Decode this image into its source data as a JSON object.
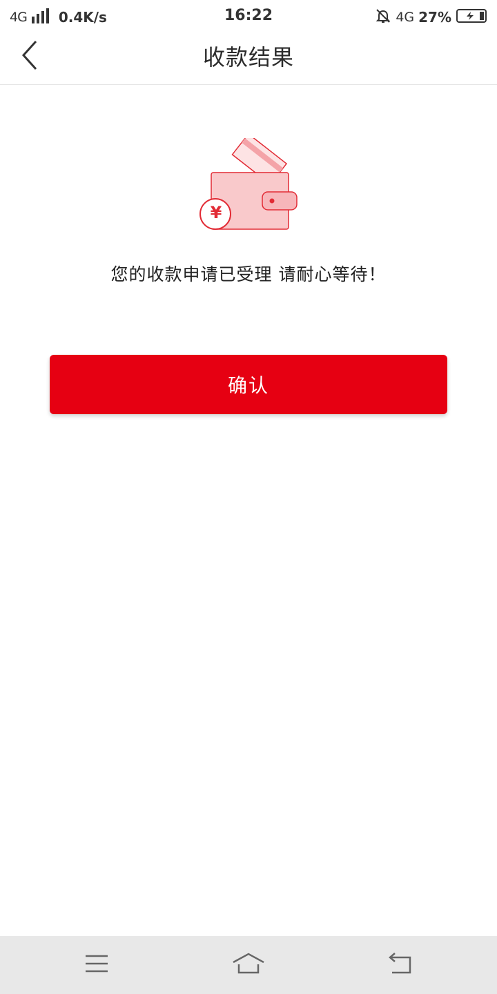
{
  "status_bar": {
    "network_left": "4G",
    "speed": "0.4K/s",
    "time": "16:22",
    "network_right": "4G",
    "battery_percent": "27%",
    "icons": [
      "signal-icon",
      "mute-icon",
      "battery-charging-icon"
    ]
  },
  "header": {
    "title": "收款结果",
    "back_icon": "chevron-left-icon"
  },
  "main": {
    "illustration_icon": "wallet-icon",
    "currency_symbol": "¥",
    "message": "您的收款申请已受理 请耐心等待！",
    "confirm_label": "确认"
  },
  "system_nav": {
    "icons": [
      "menu-icon",
      "home-icon",
      "back-icon"
    ]
  },
  "colors": {
    "accent": "#e60012",
    "illustration_fill": "#f9c9cb",
    "illustration_stroke": "#e22b35"
  }
}
